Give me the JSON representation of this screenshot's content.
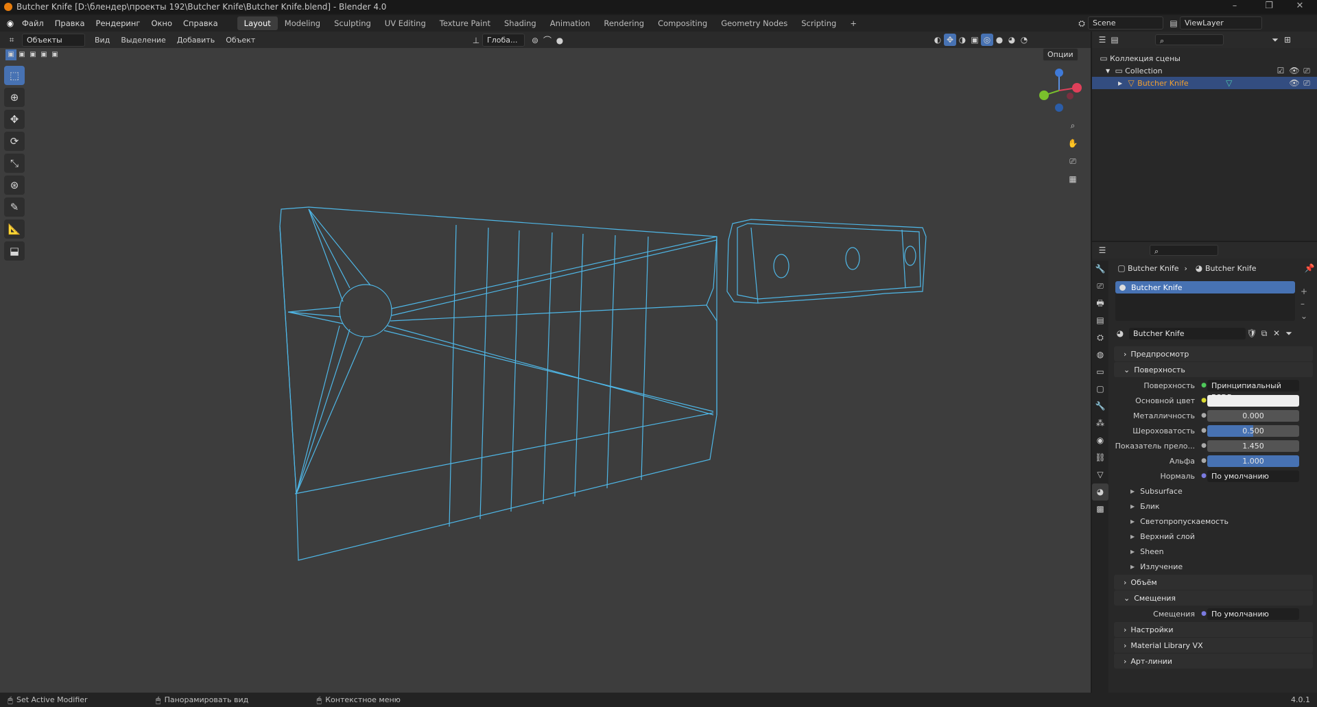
{
  "window": {
    "title": "Butcher Knife [D:\\блендер\\проекты 192\\Butcher Knife\\Butcher Knife.blend] - Blender 4.0"
  },
  "menu": [
    "Файл",
    "Правка",
    "Рендеринг",
    "Окно",
    "Справка"
  ],
  "workspaces": [
    "Layout",
    "Modeling",
    "Sculpting",
    "UV Editing",
    "Texture Paint",
    "Shading",
    "Animation",
    "Rendering",
    "Compositing",
    "Geometry Nodes",
    "Scripting"
  ],
  "active_workspace": "Layout",
  "scene": "Scene",
  "view_layer": "ViewLayer",
  "viewport_header": {
    "mode": "Объекты",
    "items": [
      "Вид",
      "Выделение",
      "Добавить",
      "Объект"
    ],
    "transform_orientation": "Глоба...",
    "options": "Опции"
  },
  "outliner": {
    "scene_collection": "Коллекция сцены",
    "collection": "Collection",
    "object": "Butcher Knife"
  },
  "properties": {
    "breadcrumb_object": "Butcher Knife",
    "breadcrumb_material": "Butcher Knife",
    "slot_name": "Butcher Knife",
    "material_name": "Butcher Knife",
    "panel_preview": "Предпросмотр",
    "panel_surface": "Поверхность",
    "surface": {
      "label": "Поверхность",
      "value": "Принципиальный BSDF"
    },
    "base_color": {
      "label": "Основной цвет",
      "color": "#ededed"
    },
    "metallic": {
      "label": "Металличность",
      "value": "0.000"
    },
    "roughness": {
      "label": "Шероховатость",
      "value": "0.500",
      "fraction": 0.5
    },
    "ior": {
      "label": "Показатель прело...",
      "value": "1.450"
    },
    "alpha": {
      "label": "Альфа",
      "value": "1.000",
      "fraction": 1.0
    },
    "normal": {
      "label": "Нормаль",
      "value": "По умолчанию"
    },
    "subpanels": [
      "Subsurface",
      "Блик",
      "Светопропускаемость",
      "Верхний слой",
      "Sheen",
      "Излучение"
    ],
    "panel_volume": "Объём",
    "panel_displacement": "Смещения",
    "displacement": {
      "label": "Смещения",
      "value": "По умолчанию"
    },
    "panel_settings": "Настройки",
    "panel_matlib": "Material Library VX",
    "panel_lineart": "Арт-линии"
  },
  "status": {
    "left": "Set Active Modifier",
    "middle": "Панорамировать вид",
    "right": "Контекстное меню",
    "version": "4.0.1"
  },
  "colors": {
    "wire": "#4fb8e8",
    "accent": "#4772b3",
    "selected_object": "#f0a030"
  }
}
